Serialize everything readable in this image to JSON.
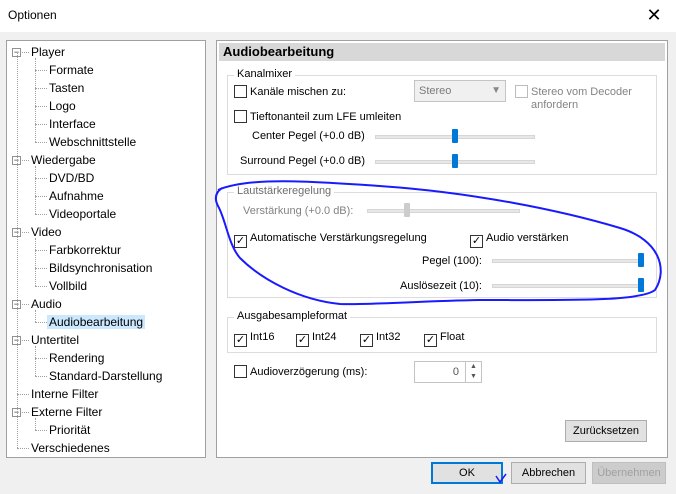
{
  "window": {
    "title": "Optionen",
    "close_glyph": "✕"
  },
  "tree": {
    "items": [
      {
        "label": "Player",
        "level": 0,
        "expander": "−"
      },
      {
        "label": "Formate",
        "level": 1
      },
      {
        "label": "Tasten",
        "level": 1
      },
      {
        "label": "Logo",
        "level": 1
      },
      {
        "label": "Interface",
        "level": 1
      },
      {
        "label": "Webschnittstelle",
        "level": 1
      },
      {
        "label": "Wiedergabe",
        "level": 0,
        "expander": "−"
      },
      {
        "label": "DVD/BD",
        "level": 1
      },
      {
        "label": "Aufnahme",
        "level": 1
      },
      {
        "label": "Videoportale",
        "level": 1
      },
      {
        "label": "Video",
        "level": 0,
        "expander": "−"
      },
      {
        "label": "Farbkorrektur",
        "level": 1
      },
      {
        "label": "Bildsynchronisation",
        "level": 1
      },
      {
        "label": "Vollbild",
        "level": 1
      },
      {
        "label": "Audio",
        "level": 0,
        "expander": "−"
      },
      {
        "label": "Audiobearbeitung",
        "level": 1,
        "selected": true
      },
      {
        "label": "Untertitel",
        "level": 0,
        "expander": "−"
      },
      {
        "label": "Rendering",
        "level": 1
      },
      {
        "label": "Standard-Darstellung",
        "level": 1
      },
      {
        "label": "Interne Filter",
        "level": 0
      },
      {
        "label": "Externe Filter",
        "level": 0,
        "expander": "−"
      },
      {
        "label": "Priorität",
        "level": 1
      },
      {
        "label": "Verschiedenes",
        "level": 0
      }
    ]
  },
  "panel": {
    "header": "Audiobearbeitung",
    "kanalmixer": {
      "label": "Kanalmixer",
      "mix_checkbox": {
        "label": "Kanäle mischen zu:",
        "checked": false
      },
      "mix_combo": {
        "value": "Stereo"
      },
      "decoder_checkbox": {
        "label_line1": "Stereo vom Decoder",
        "label_line2": "anfordern",
        "checked": false
      },
      "lfe_checkbox": {
        "label": "Tiefton­anteil zum LFE umleiten",
        "checked": false
      },
      "center_label": "Center Pegel (+0.0 dB)",
      "center_level": 0.5,
      "surround_label": "Surround Pegel (+0.0 dB)",
      "surround_level": 0.5
    },
    "lautstaerke": {
      "label": "Lautstärkeregelung",
      "gain_label": "Verstärkung (+0.0 dB):",
      "gain_level": 0.25,
      "auto_checkbox": {
        "label": "Automatische Verstärkungsregelung",
        "checked": true
      },
      "boost_checkbox": {
        "label": "Audio verstärken",
        "checked": true
      },
      "pegel_label": "Pegel (100):",
      "pegel_level": 1.0,
      "ausloese_label": "Auslösezeit (10):",
      "ausloese_level": 1.0
    },
    "ausgabe": {
      "label": "Ausgabesampleformat",
      "formats": [
        {
          "label": "Int16",
          "checked": true
        },
        {
          "label": "Int24",
          "checked": true
        },
        {
          "label": "Int32",
          "checked": true
        },
        {
          "label": "Float",
          "checked": true
        }
      ]
    },
    "delay": {
      "label": "Audioverzögerung (ms):",
      "checked": false,
      "value": "0"
    },
    "reset_button": "Zurücksetzen"
  },
  "buttons": {
    "ok": "OK",
    "cancel": "Abbrechen",
    "apply": "Übernehmen"
  },
  "colors": {
    "accent": "#0078d7",
    "annotation": "#1a1aff",
    "selection": "#cce8ff"
  }
}
